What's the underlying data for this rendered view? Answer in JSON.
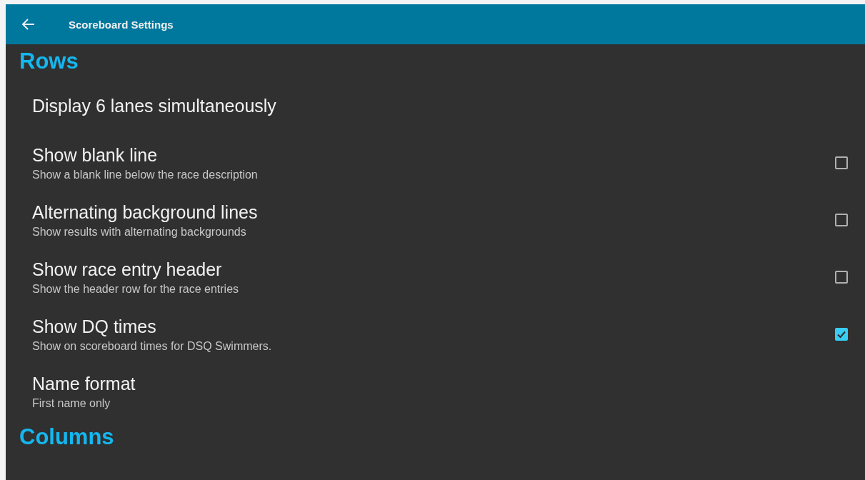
{
  "app_bar": {
    "title": "Scoreboard Settings"
  },
  "sections": [
    {
      "title": "Rows",
      "items": [
        {
          "kind": "plain",
          "title": "Display 6 lanes simultaneously"
        },
        {
          "kind": "checkbox",
          "title": "Show blank line",
          "summary": "Show a blank line below the race description",
          "checked": false
        },
        {
          "kind": "checkbox",
          "title": "Alternating background lines",
          "summary": "Show results with alternating backgrounds",
          "checked": false
        },
        {
          "kind": "checkbox",
          "title": "Show race entry header",
          "summary": "Show the header row for the race entries",
          "checked": false
        },
        {
          "kind": "checkbox",
          "title": "Show DQ times",
          "summary": "Show on scoreboard times for DSQ Swimmers.",
          "checked": true
        },
        {
          "kind": "plain",
          "title": "Name format",
          "summary": "First name only"
        }
      ]
    },
    {
      "title": "Columns"
    }
  ]
}
